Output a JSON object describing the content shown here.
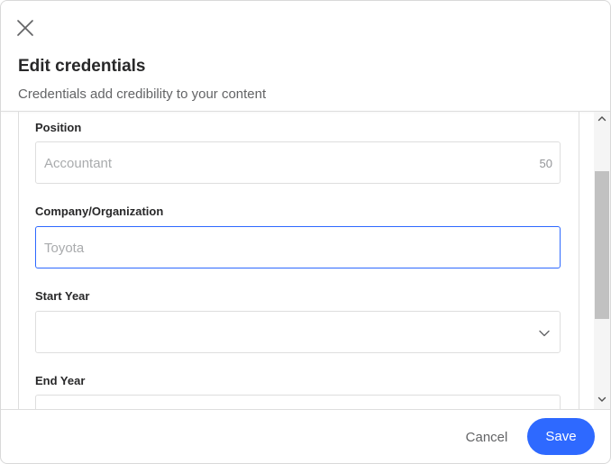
{
  "dialog": {
    "title": "Edit credentials",
    "subtitle": "Credentials add credibility to your content",
    "close_icon": "close-icon"
  },
  "form": {
    "position": {
      "label": "Position",
      "placeholder": "Accountant",
      "value": "",
      "char_remaining": "50"
    },
    "company": {
      "label": "Company/Organization",
      "placeholder": "Toyota",
      "value": ""
    },
    "start_year": {
      "label": "Start Year",
      "selected": "",
      "icon": "chevron-down-icon"
    },
    "end_year": {
      "label": "End Year",
      "selected": ""
    }
  },
  "footer": {
    "cancel_label": "Cancel",
    "save_label": "Save"
  },
  "colors": {
    "accent": "#2e69ff",
    "border": "#dedede",
    "placeholder": "#a9abad"
  }
}
